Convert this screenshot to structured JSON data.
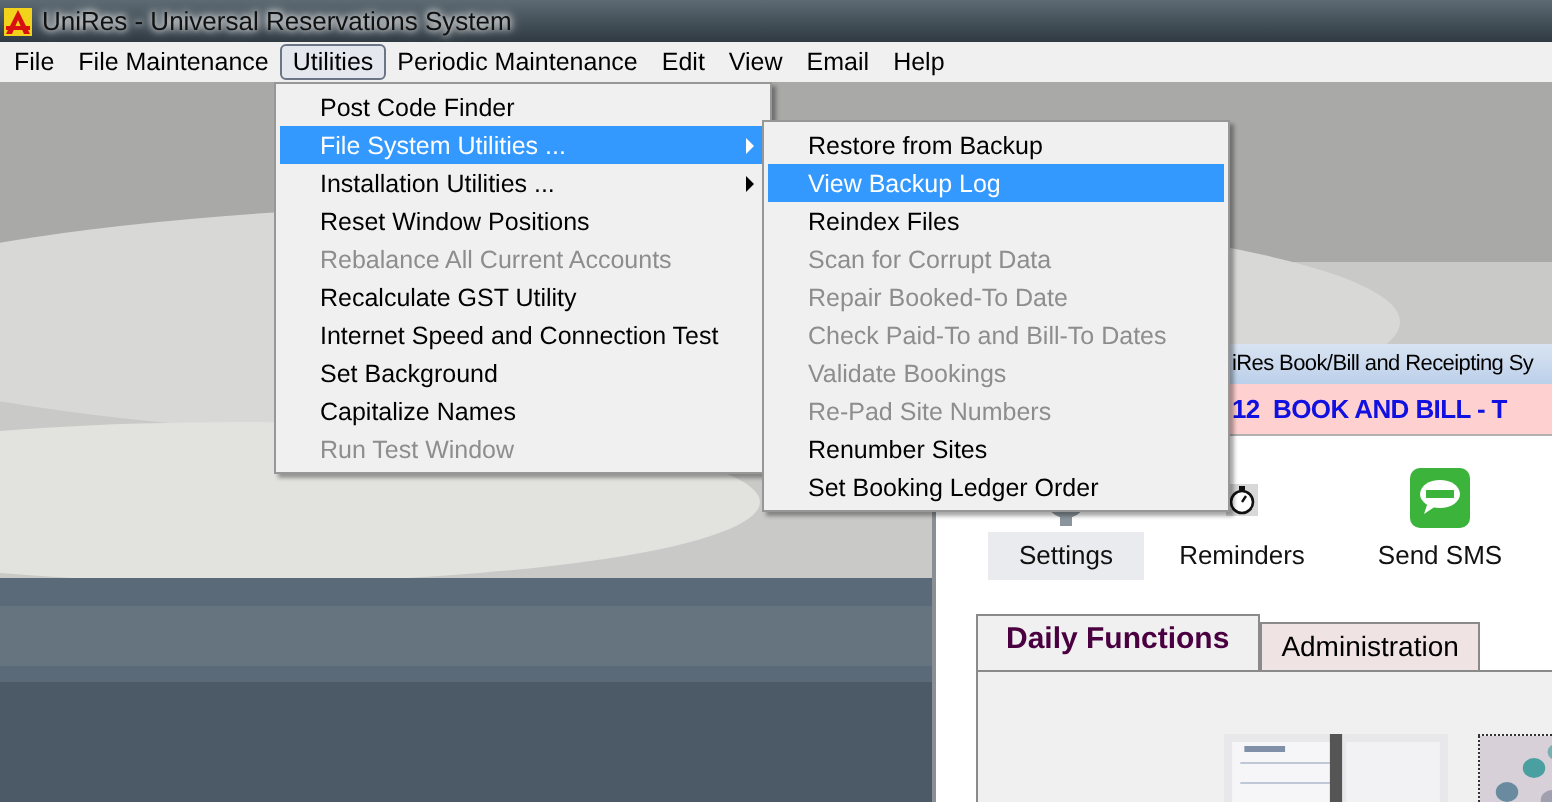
{
  "window": {
    "title": "UniRes - Universal Reservations System"
  },
  "menu_bar": [
    {
      "label": "File",
      "selected": false
    },
    {
      "label": "File Maintenance",
      "selected": false
    },
    {
      "label": "Utilities",
      "selected": true
    },
    {
      "label": "Periodic Maintenance",
      "selected": false
    },
    {
      "label": "Edit",
      "selected": false
    },
    {
      "label": "View",
      "selected": false
    },
    {
      "label": "Email",
      "selected": false
    },
    {
      "label": "Help",
      "selected": false
    }
  ],
  "utilities_menu": [
    {
      "label": "Post Code Finder",
      "disabled": false,
      "selected": false,
      "submenu": false
    },
    {
      "label": "File System Utilities ...",
      "disabled": false,
      "selected": true,
      "submenu": true
    },
    {
      "label": "Installation Utilities ...",
      "disabled": false,
      "selected": false,
      "submenu": true
    },
    {
      "label": "Reset Window Positions",
      "disabled": false,
      "selected": false,
      "submenu": false
    },
    {
      "label": "Rebalance All Current Accounts",
      "disabled": true,
      "selected": false,
      "submenu": false
    },
    {
      "label": "Recalculate GST Utility",
      "disabled": false,
      "selected": false,
      "submenu": false
    },
    {
      "label": "Internet Speed and Connection Test",
      "disabled": false,
      "selected": false,
      "submenu": false
    },
    {
      "label": "Set Background",
      "disabled": false,
      "selected": false,
      "submenu": false
    },
    {
      "label": "Capitalize Names",
      "disabled": false,
      "selected": false,
      "submenu": false
    },
    {
      "label": "Run Test Window",
      "disabled": true,
      "selected": false,
      "submenu": false
    }
  ],
  "file_system_submenu": [
    {
      "label": "Restore from Backup",
      "disabled": false,
      "selected": false
    },
    {
      "label": "View Backup Log",
      "disabled": false,
      "selected": true
    },
    {
      "label": "Reindex Files",
      "disabled": false,
      "selected": false
    },
    {
      "label": "Scan for Corrupt Data",
      "disabled": true,
      "selected": false
    },
    {
      "label": "Repair Booked-To Date",
      "disabled": true,
      "selected": false
    },
    {
      "label": "Check Paid-To and Bill-To Dates",
      "disabled": true,
      "selected": false
    },
    {
      "label": "Validate Bookings",
      "disabled": true,
      "selected": false
    },
    {
      "label": "Re-Pad Site Numbers",
      "disabled": true,
      "selected": false
    },
    {
      "label": "Renumber Sites",
      "disabled": false,
      "selected": false
    },
    {
      "label": "Set Booking Ledger Order",
      "disabled": false,
      "selected": false
    }
  ],
  "inner_window": {
    "title": "iRes Book/Bill and Receipting Sy",
    "header": "12  BOOK AND BILL - T",
    "toolbar": [
      {
        "kind": "settings",
        "label": "Settings",
        "highlighted": true
      },
      {
        "kind": "reminders",
        "label": "Reminders",
        "highlighted": false
      },
      {
        "kind": "sms",
        "label": "Send SMS",
        "highlighted": false
      }
    ],
    "tabs": [
      {
        "label": "Daily Functions",
        "selected": true
      },
      {
        "label": "Administration",
        "selected": false
      }
    ]
  }
}
